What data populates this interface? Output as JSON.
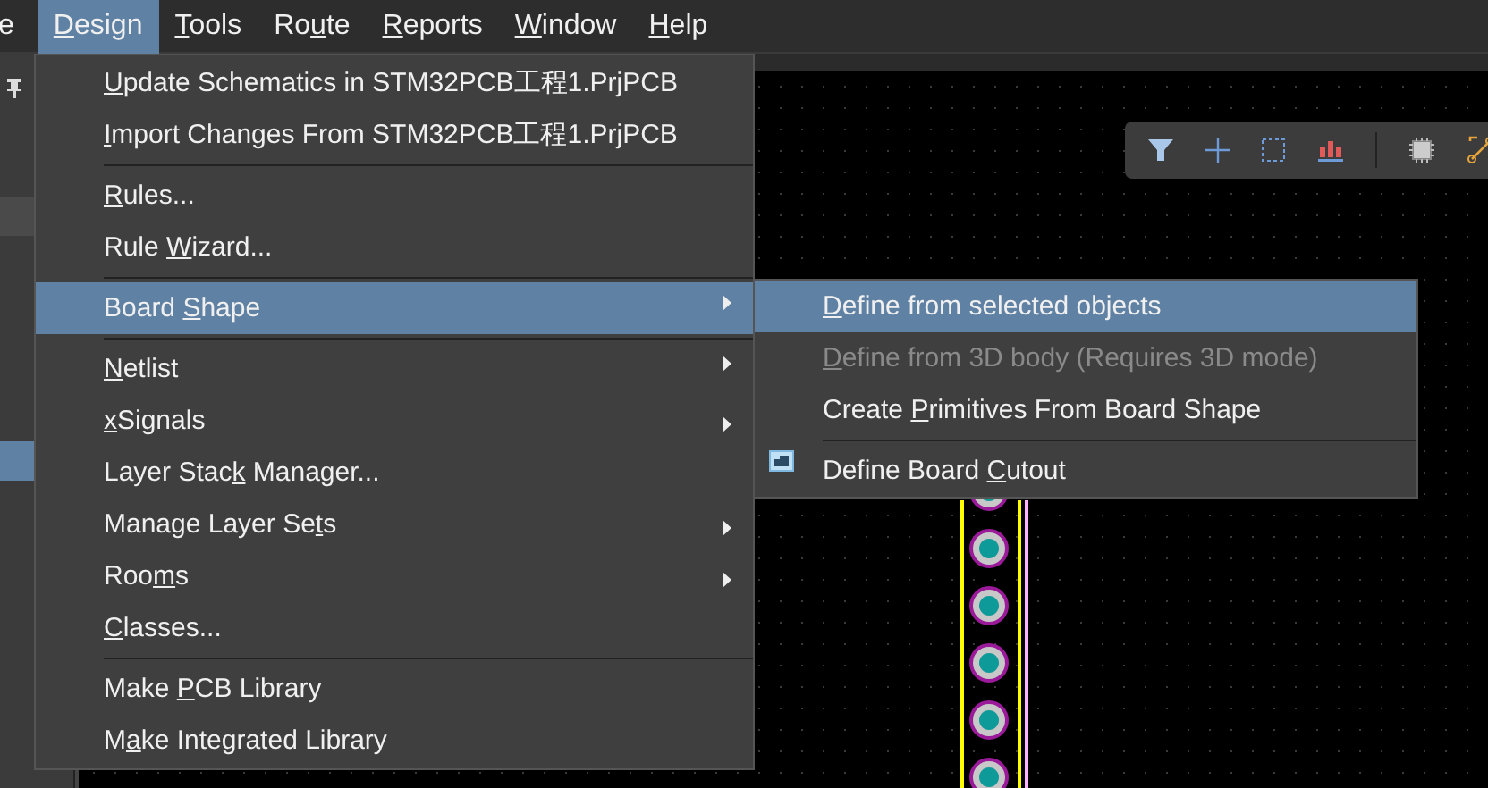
{
  "menubar": [
    {
      "after": "e",
      "selected": false
    },
    {
      "key": "D",
      "after": "esign",
      "selected": true
    },
    {
      "key": "T",
      "after": "ools",
      "selected": false
    },
    {
      "before": "Ro",
      "key": "u",
      "after": "te",
      "selected": false
    },
    {
      "key": "R",
      "after": "eports",
      "selected": false
    },
    {
      "key": "W",
      "after": "indow",
      "selected": false
    },
    {
      "key": "H",
      "after": "elp",
      "selected": false
    }
  ],
  "design_menu": [
    {
      "key": "U",
      "after": "pdate Schematics in STM32PCB工程1.PrjPCB",
      "selected": false,
      "has_submenu": false,
      "separator_before": false
    },
    {
      "key": "I",
      "after": "mport Changes From STM32PCB工程1.PrjPCB",
      "selected": false,
      "has_submenu": false,
      "separator_before": false
    },
    {
      "key": "R",
      "after": "ules...",
      "selected": false,
      "has_submenu": false,
      "separator_before": true
    },
    {
      "before": "Rule ",
      "key": "W",
      "after": "izard...",
      "selected": false,
      "has_submenu": false,
      "separator_before": false
    },
    {
      "before": "Board ",
      "key": "S",
      "after": "hape",
      "selected": true,
      "has_submenu": true,
      "separator_before": true
    },
    {
      "key": "N",
      "after": "etlist",
      "selected": false,
      "has_submenu": true,
      "separator_before": true
    },
    {
      "key": "x",
      "after": "Signals",
      "selected": false,
      "has_submenu": true,
      "separator_before": false
    },
    {
      "before": "Layer Stac",
      "key": "k",
      "after": " Manager...",
      "selected": false,
      "has_submenu": false,
      "separator_before": false
    },
    {
      "before": "Manage Layer Se",
      "key": "t",
      "after": "s",
      "selected": false,
      "has_submenu": true,
      "separator_before": false
    },
    {
      "before": "Roo",
      "key": "m",
      "after": "s",
      "selected": false,
      "has_submenu": true,
      "separator_before": false
    },
    {
      "key": "C",
      "after": "lasses...",
      "selected": false,
      "has_submenu": false,
      "separator_before": false
    },
    {
      "before": "Make ",
      "key": "P",
      "after": "CB Library",
      "selected": false,
      "has_submenu": false,
      "separator_before": true
    },
    {
      "before": "M",
      "key": "a",
      "after": "ke Integrated Library",
      "selected": false,
      "has_submenu": false,
      "separator_before": false
    }
  ],
  "board_shape_submenu": [
    {
      "kind": "plain",
      "key": "D",
      "after": "efine from selected objects",
      "selected": true,
      "disabled": false,
      "separator_before": false
    },
    {
      "kind": "plain",
      "key": "D",
      "after": "efine from 3D body (Requires 3D mode)",
      "selected": false,
      "disabled": true,
      "separator_before": false
    },
    {
      "kind": "plain",
      "before": "Create ",
      "key": "P",
      "after": "rimitives From Board Shape",
      "selected": false,
      "disabled": false,
      "separator_before": false
    },
    {
      "kind": "with-icon",
      "before": "Define Board ",
      "key": "C",
      "after": "utout",
      "selected": false,
      "disabled": false,
      "separator_before": true
    }
  ]
}
